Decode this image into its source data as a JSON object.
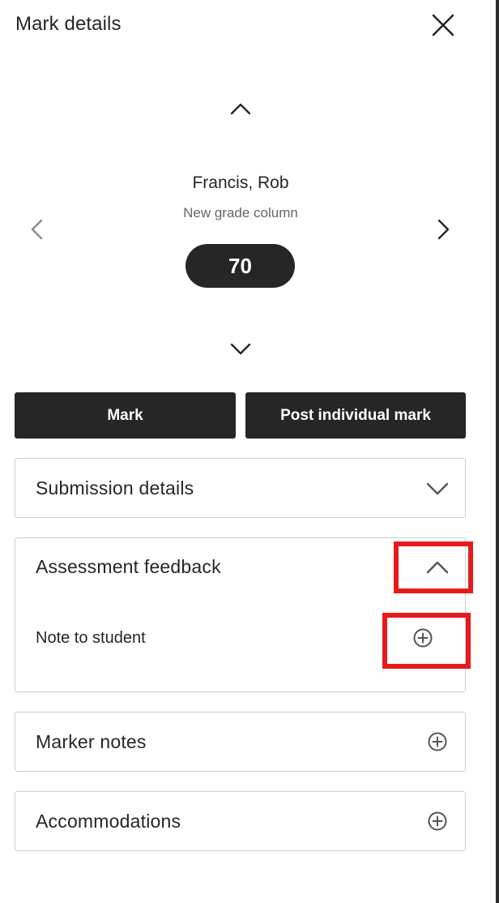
{
  "header": {
    "title": "Mark details",
    "close_icon": "close-icon"
  },
  "navigator": {
    "up_icon": "chevron-up-icon",
    "down_icon": "chevron-down-icon",
    "prev_icon": "chevron-left-icon",
    "next_icon": "chevron-right-icon",
    "student_name": "Francis, Rob",
    "column_name": "New grade column",
    "grade": "70"
  },
  "actions": {
    "mark_label": "Mark",
    "post_label": "Post individual mark"
  },
  "panels": {
    "submission_details": {
      "title": "Submission details",
      "state": "collapsed",
      "icon": "chevron-down-icon"
    },
    "assessment_feedback": {
      "title": "Assessment feedback",
      "state": "expanded",
      "icon": "chevron-up-icon",
      "note_label": "Note to student",
      "note_icon": "plus-circle-icon"
    },
    "marker_notes": {
      "title": "Marker notes",
      "icon": "plus-circle-icon"
    },
    "accommodations": {
      "title": "Accommodations",
      "icon": "plus-circle-icon"
    }
  },
  "colors": {
    "text": "#262626",
    "muted": "#666666",
    "button_bg": "#262626",
    "button_text": "#ffffff",
    "panel_border": "#cdcdcd",
    "highlight": "#e51b1b"
  }
}
